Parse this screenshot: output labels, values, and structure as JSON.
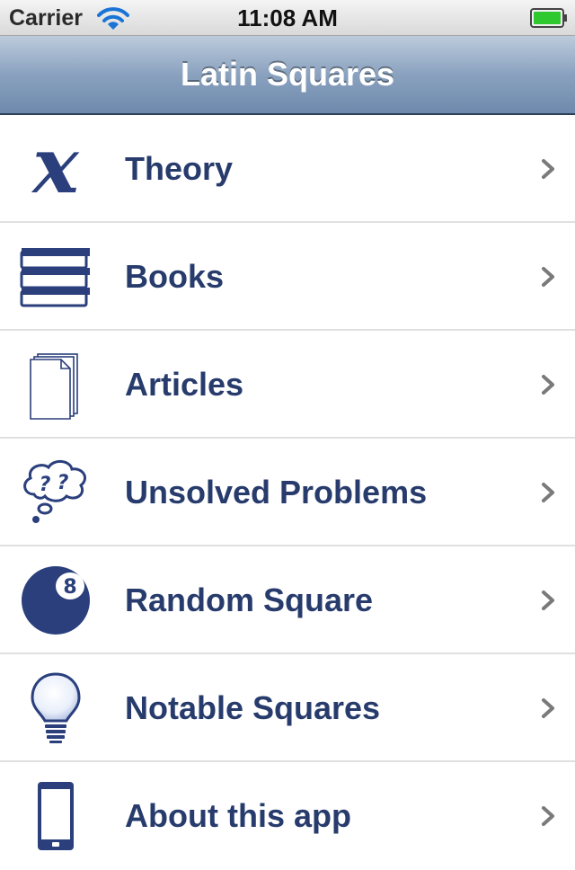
{
  "status_bar": {
    "carrier": "Carrier",
    "time": "11:08 AM",
    "icons": [
      "wifi-icon",
      "battery-icon"
    ]
  },
  "nav": {
    "title": "Latin Squares"
  },
  "colors": {
    "label": "#273b6c",
    "icon": "#2a3f7c",
    "nav_gradient_top": "#bccbdc",
    "nav_gradient_bottom": "#6e89ac"
  },
  "menu": {
    "items": [
      {
        "label": "Theory",
        "icon": "variable-x-icon"
      },
      {
        "label": "Books",
        "icon": "books-icon"
      },
      {
        "label": "Articles",
        "icon": "documents-icon"
      },
      {
        "label": "Unsolved Problems",
        "icon": "question-thought-bubble-icon"
      },
      {
        "label": "Random Square",
        "icon": "eight-ball-icon"
      },
      {
        "label": "Notable Squares",
        "icon": "lightbulb-icon"
      },
      {
        "label": "About this app",
        "icon": "phone-icon"
      }
    ]
  }
}
